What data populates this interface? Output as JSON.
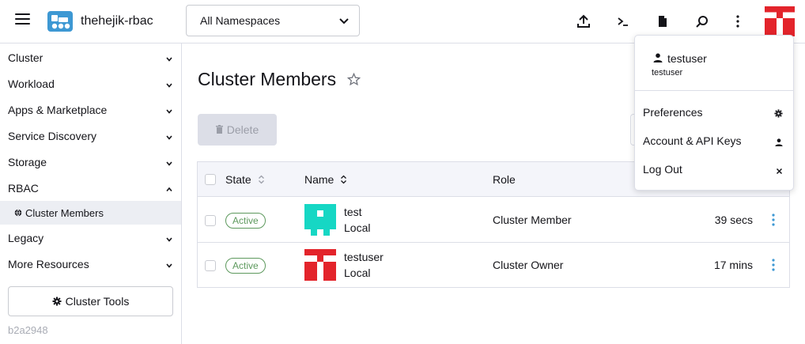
{
  "header": {
    "cluster_name": "thehejik-rbac",
    "namespace_select": "All Namespaces",
    "icons": [
      "upload-icon",
      "terminal-icon",
      "file-icon",
      "search-icon",
      "more-vertical-icon"
    ],
    "accent_color": "#3d98d3"
  },
  "sidebar": {
    "items": [
      {
        "label": "Cluster",
        "expanded": false
      },
      {
        "label": "Workload",
        "expanded": false
      },
      {
        "label": "Apps & Marketplace",
        "expanded": false
      },
      {
        "label": "Service Discovery",
        "expanded": false
      },
      {
        "label": "Storage",
        "expanded": false
      },
      {
        "label": "RBAC",
        "expanded": true
      },
      {
        "label": "Legacy",
        "expanded": false
      },
      {
        "label": "More Resources",
        "expanded": false
      }
    ],
    "active_sub": "Cluster Members",
    "cluster_tools_label": "Cluster Tools",
    "version": "b2a2948"
  },
  "main": {
    "title": "Cluster Members",
    "delete_label": "Delete",
    "table": {
      "headers": {
        "state": "State",
        "name": "Name",
        "role": "Role"
      },
      "rows": [
        {
          "state": "Active",
          "name": "test",
          "provider": "Local",
          "role": "Cluster Member",
          "age": "39 secs",
          "avatar_color": "#16d7c4"
        },
        {
          "state": "Active",
          "name": "testuser",
          "provider": "Local",
          "role": "Cluster Owner",
          "age": "17 mins",
          "avatar_color": "#e3242b"
        }
      ]
    }
  },
  "user_menu": {
    "display_name": "testuser",
    "login": "testuser",
    "items": [
      {
        "label": "Preferences",
        "icon": "gear-icon"
      },
      {
        "label": "Account & API Keys",
        "icon": "user-icon"
      },
      {
        "label": "Log Out",
        "icon": "close-icon"
      }
    ]
  }
}
